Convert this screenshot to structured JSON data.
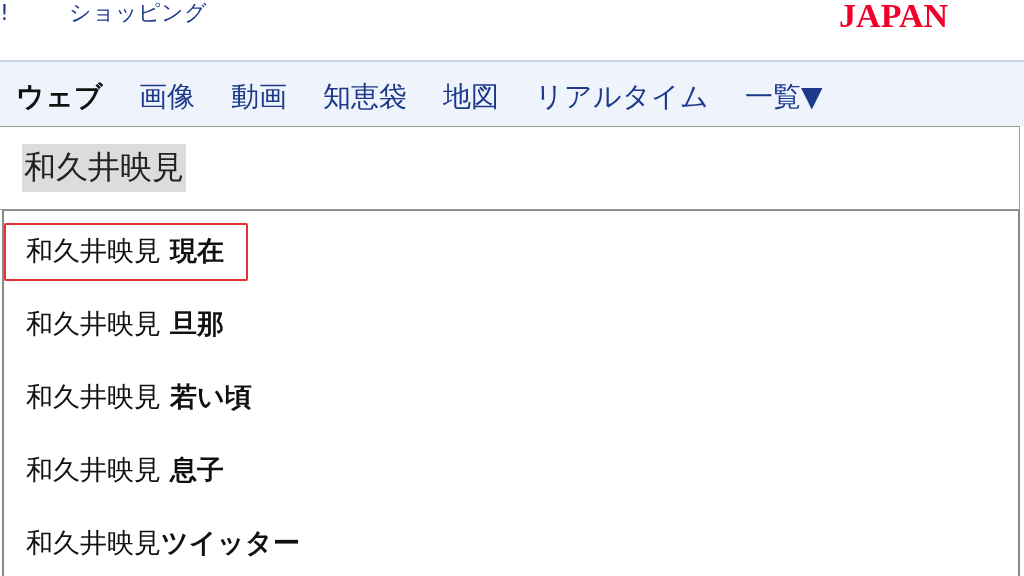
{
  "header": {
    "left_fragment": "!",
    "link": "ショッピング",
    "logo": "JAPAN"
  },
  "tabs": [
    {
      "label": "ウェブ",
      "selected": true
    },
    {
      "label": "画像",
      "selected": false
    },
    {
      "label": "動画",
      "selected": false
    },
    {
      "label": "知恵袋",
      "selected": false
    },
    {
      "label": "地図",
      "selected": false
    },
    {
      "label": "リアルタイム",
      "selected": false
    },
    {
      "label": "一覧▼",
      "selected": false
    }
  ],
  "search": {
    "value": "和久井映見",
    "highlighted": true
  },
  "suggestions": [
    {
      "text": "和久井映見 **現在**",
      "selected": true
    },
    {
      "text": "和久井映見 **旦那**",
      "selected": false
    },
    {
      "text": "和久井映見 **若い頃**",
      "selected": false
    },
    {
      "text": "和久井映見 **息子**",
      "selected": false
    },
    {
      "text": "和久井映見**ツイッター**",
      "selected": false
    }
  ]
}
